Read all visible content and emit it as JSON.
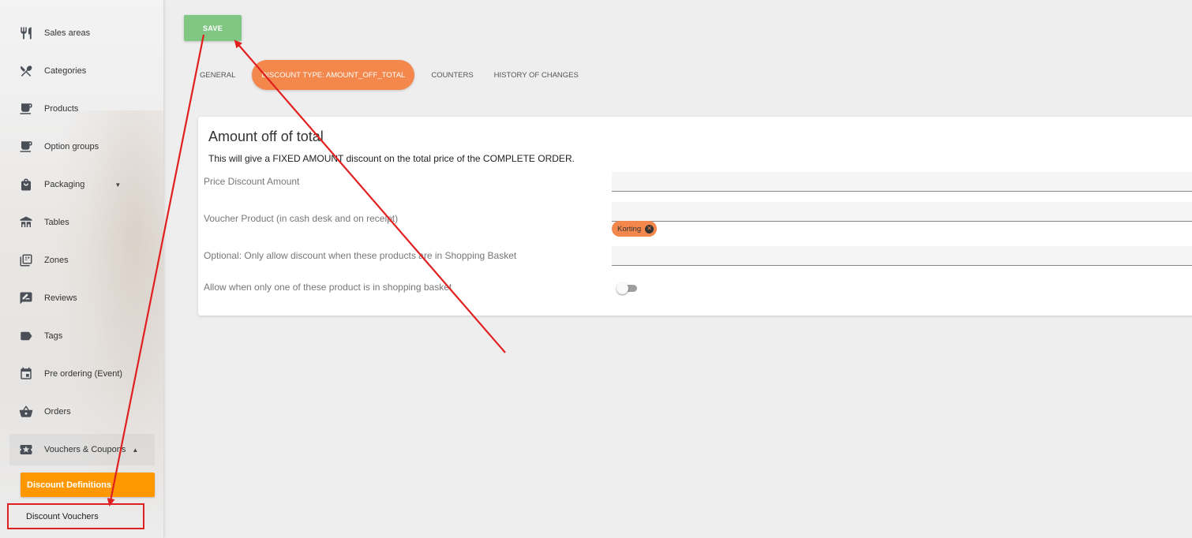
{
  "sidebar": {
    "items": [
      {
        "label": "Sales areas",
        "icon": "cutlery-icon"
      },
      {
        "label": "Categories",
        "icon": "utensils-cross-icon"
      },
      {
        "label": "Products",
        "icon": "coffee-icon"
      },
      {
        "label": "Option groups",
        "icon": "coffee-icon"
      },
      {
        "label": "Packaging",
        "icon": "shopping-bag-icon",
        "caret": "▼"
      },
      {
        "label": "Tables",
        "icon": "table-icon"
      },
      {
        "label": "Zones",
        "icon": "zones-icon"
      },
      {
        "label": "Reviews",
        "icon": "rate-review-icon"
      },
      {
        "label": "Tags",
        "icon": "label-tag-icon"
      },
      {
        "label": "Pre ordering (Event)",
        "icon": "calendar-event-icon"
      },
      {
        "label": "Orders",
        "icon": "basket-icon"
      },
      {
        "label": "Vouchers & Coupons",
        "icon": "ticket-icon",
        "caret": "▲"
      }
    ],
    "subitems": [
      {
        "label": "Discount Definitions"
      },
      {
        "label": "Discount Vouchers"
      }
    ]
  },
  "toolbar": {
    "save_label": "SAVE"
  },
  "tabs": [
    {
      "label": "GENERAL"
    },
    {
      "label": "DISCOUNT TYPE: AMOUNT_OFF_TOTAL"
    },
    {
      "label": "COUNTERS"
    },
    {
      "label": "HISTORY OF CHANGES"
    }
  ],
  "card": {
    "title": "Amount off of total",
    "description": "This will give a FIXED AMOUNT discount on the total price of the COMPLETE ORDER.",
    "fields": [
      {
        "label": "Price Discount Amount",
        "value": ""
      },
      {
        "label": "Voucher Product (in cash desk and on receipt)",
        "value": ""
      },
      {
        "label": "Optional: Only allow discount when these products are in Shopping Basket",
        "value": ""
      },
      {
        "label": "Allow when only one of these product is in shopping basket"
      }
    ],
    "chip_label": "Korting",
    "toggle_on": false
  },
  "colors": {
    "accent_orange": "#ff9800",
    "tab_active": "#f4874b",
    "save_green": "#81c784",
    "annotation_red": "#e02020"
  }
}
